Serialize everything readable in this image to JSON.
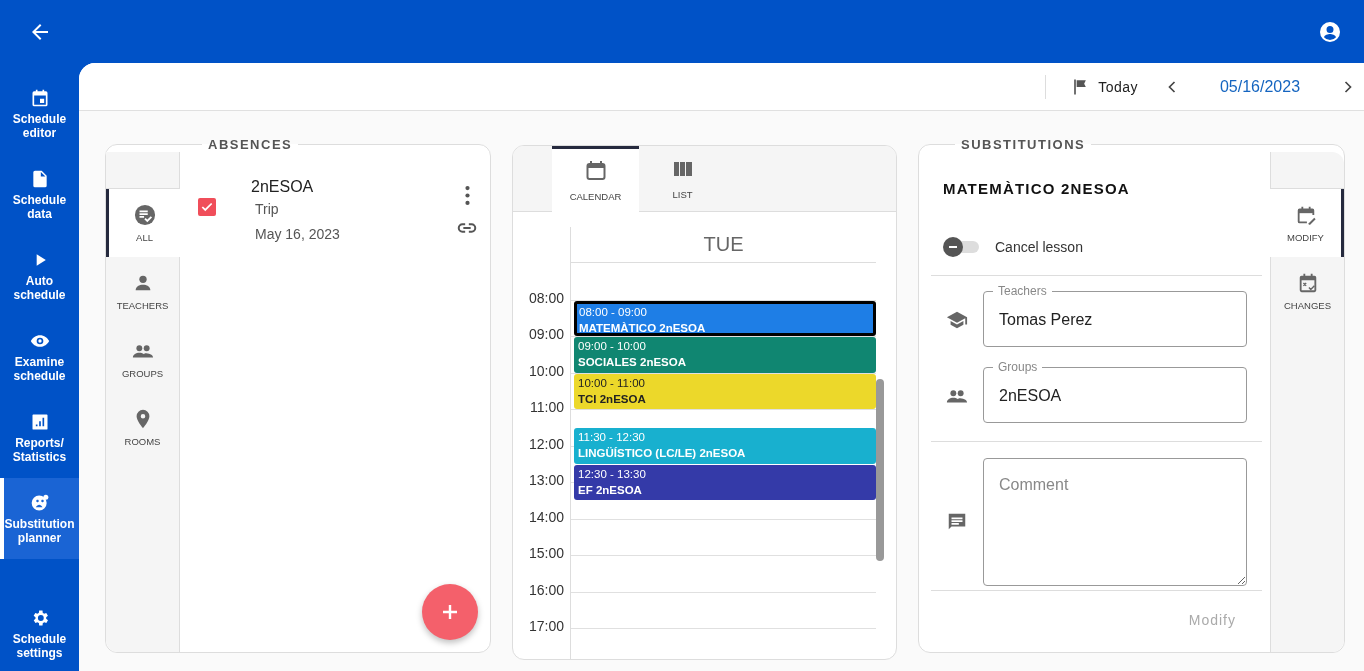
{
  "sidebar": {
    "items": [
      {
        "lines": [
          "Schedule",
          "editor"
        ],
        "selected": false
      },
      {
        "lines": [
          "Schedule",
          "data"
        ],
        "selected": false
      },
      {
        "lines": [
          "Auto",
          "schedule"
        ],
        "selected": false
      },
      {
        "lines": [
          "Examine",
          "schedule"
        ],
        "selected": false
      },
      {
        "lines": [
          "Reports/",
          "Statistics"
        ],
        "selected": false
      },
      {
        "lines": [
          "Substitution",
          "planner"
        ],
        "selected": true
      }
    ],
    "footer_item": {
      "lines": [
        "Schedule",
        "settings"
      ]
    }
  },
  "toolbar": {
    "today": "Today",
    "date": "05/16/2023"
  },
  "absences": {
    "title": "ABSENCES",
    "tabs": [
      {
        "label": "ALL",
        "selected": true
      },
      {
        "label": "TEACHERS",
        "selected": false
      },
      {
        "label": "GROUPS",
        "selected": false
      },
      {
        "label": "ROOMS",
        "selected": false
      }
    ],
    "items": [
      {
        "name": "2nESOA",
        "reason": "Trip",
        "date": "May 16, 2023",
        "checked": true
      }
    ]
  },
  "calendar": {
    "tabs": [
      {
        "label": "CALENDAR",
        "selected": true
      },
      {
        "label": "LIST",
        "selected": false
      }
    ],
    "day": "TUE",
    "hours": [
      "08:00",
      "09:00",
      "10:00",
      "11:00",
      "12:00",
      "13:00",
      "14:00",
      "15:00",
      "16:00",
      "17:00"
    ],
    "events": [
      {
        "time": "08:00 - 09:00",
        "title": "MATEMÀTICO 2nESOA",
        "color": "#1e7ee6",
        "selected": true
      },
      {
        "time": "09:00 - 10:00",
        "title": "SOCIALES 2nESOA",
        "color": "#108671",
        "selected": false
      },
      {
        "time": "10:00 - 11:00",
        "title": "TCI 2nESOA",
        "color": "#ecd82a",
        "selected": false
      },
      {
        "time": "11:30 - 12:30",
        "title": "LINGÜÍSTICO (LC/LE) 2nESOA",
        "color": "#18b0cf",
        "selected": false
      },
      {
        "time": "12:30 - 13:30",
        "title": "EF 2nESOA",
        "color": "#343aa8",
        "selected": false
      }
    ]
  },
  "substitutions": {
    "title": "SUBSTITUTIONS",
    "lesson": "MATEMÀTICO 2NESOA",
    "cancel_lesson": {
      "label": "Cancel lesson",
      "on": false
    },
    "teachers": {
      "label": "Teachers",
      "value": "Tomas Perez"
    },
    "groups": {
      "label": "Groups",
      "value": "2nESOA"
    },
    "comment": {
      "placeholder": "Comment"
    },
    "modify_button": {
      "label": "Modify",
      "disabled": true
    },
    "tabs": [
      {
        "label": "MODIFY",
        "selected": true
      },
      {
        "label": "CHANGES",
        "selected": false
      }
    ]
  }
}
